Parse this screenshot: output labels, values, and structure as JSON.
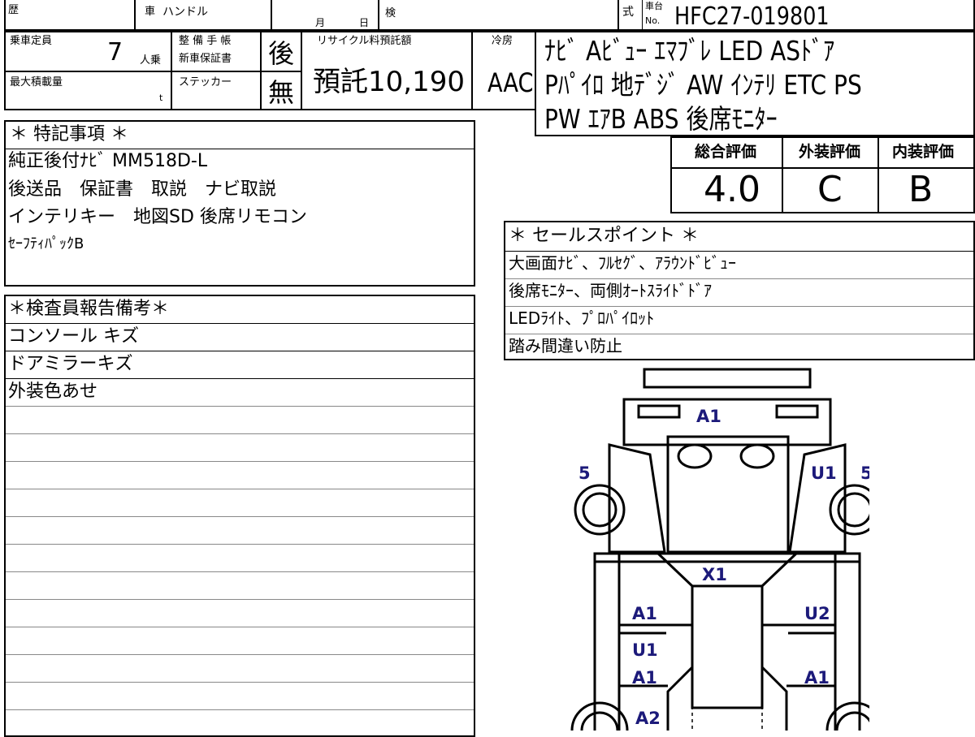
{
  "header": {
    "reki": "歴",
    "sha": "車",
    "handle": "ハンドル",
    "month": "月",
    "day": "日",
    "ken": "検",
    "shiki": "式",
    "chassis_top": "車台",
    "chassis_no": "No.",
    "chassis_number": "HFC27-019801"
  },
  "capacity": {
    "label": "乗車定員",
    "value": "7",
    "unit": "人乗"
  },
  "maintenance": {
    "label1": "整 備 手 帳",
    "label2": "新車保証書",
    "value": "後"
  },
  "max_load": {
    "label": "最大積載量",
    "unit": "t"
  },
  "sticker": {
    "label": "ステッカー",
    "value": "無"
  },
  "recycle": {
    "label": "リサイクル料預託額",
    "value": "預託10,190"
  },
  "cooling": {
    "label": "冷房",
    "value": "AAC"
  },
  "equipment": {
    "line1": "ﾅﾋﾞ Aﾋﾞｭｰ ｴﾏﾌﾞﾚ LED ASﾄﾞｱ",
    "line2": "Pﾊﾟｲﾛ 地ﾃﾞｼﾞ AW ｲﾝﾃﾘ ETC PS",
    "line3": "PW ｴｱB ABS 後席ﾓﾆﾀｰ"
  },
  "ratings": {
    "overall_label": "総合評価",
    "overall": "4.0",
    "exterior_label": "外装評価",
    "exterior": "C",
    "interior_label": "内装評価",
    "interior": "B"
  },
  "special_notes": {
    "title": "＊ 特記事項 ＊",
    "lines": [
      "純正後付ﾅﾋﾞ MM518D-L",
      "後送品　保証書　取説　ナビ取説",
      "インテリキー　地図SD 後席リモコン",
      "ｾｰﾌﾃｨﾊﾟｯｸB"
    ]
  },
  "inspector": {
    "title": "＊検査員報告備考＊",
    "lines": [
      "コンソール キズ",
      "ドアミラーキズ",
      "外装色あせ"
    ]
  },
  "sales_points": {
    "title": "＊ セールスポイント ＊",
    "lines": [
      "大画面ﾅﾋﾞ、ﾌﾙｾｸﾞ、ｱﾗｳﾝﾄﾞﾋﾞｭｰ",
      "後席ﾓﾆﾀｰ、両側ｵｰﾄｽﾗｲﾄﾞﾄﾞｱ",
      "LEDﾗｲﾄ、ﾌﾟﾛﾊﾟｲﾛｯﾄ",
      "踏み間違い防止"
    ]
  },
  "diagram_marks": {
    "hood": "A1",
    "front_left": "5",
    "front_right_code": "U1",
    "front_right": "5",
    "roof": "X1",
    "left_door_front": "A1",
    "right_door_front": "U2",
    "left_slide_1": "U1",
    "left_slide_2": "A1",
    "right_slide": "A1",
    "left_rear": "A2"
  },
  "colors": {
    "mark": "#1c1a7a",
    "line": "#000000"
  }
}
